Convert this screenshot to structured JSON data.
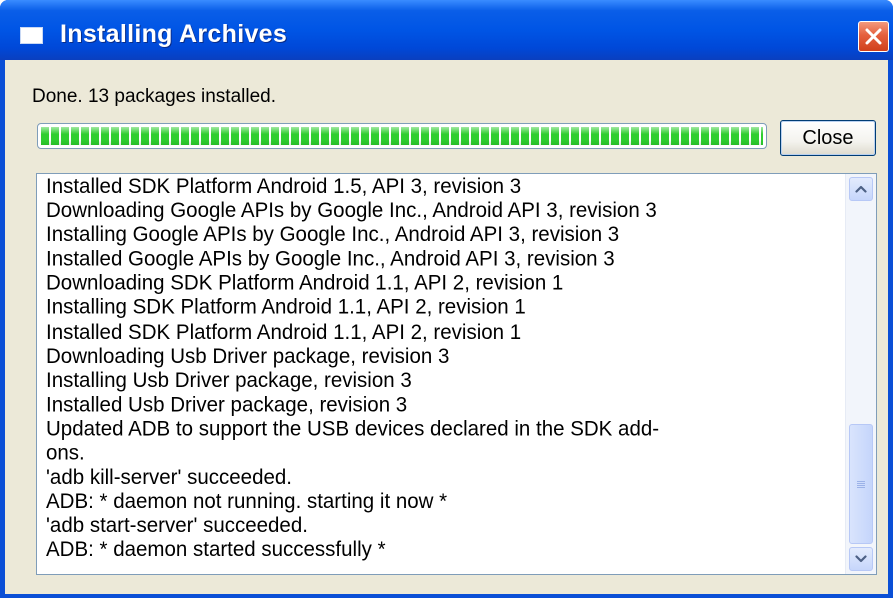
{
  "window": {
    "title": "Installing Archives",
    "icon": "window-icon",
    "close_icon": "close-icon"
  },
  "status": {
    "text": "Done. 13 packages installed."
  },
  "progress": {
    "value": 1.0,
    "color": "#2fce2f"
  },
  "buttons": {
    "close_label": "Close"
  },
  "log": {
    "lines": [
      "Installed SDK Platform Android 1.5, API 3, revision 3",
      "Downloading Google APIs by Google Inc., Android API 3, revision 3",
      "Installing Google APIs by Google Inc., Android API 3, revision 3",
      "Installed Google APIs by Google Inc., Android API 3, revision 3",
      "Downloading SDK Platform Android 1.1, API 2, revision 1",
      "Installing SDK Platform Android 1.1, API 2, revision 1",
      "Installed SDK Platform Android 1.1, API 2, revision 1",
      "Downloading Usb Driver package, revision 3",
      "Installing Usb Driver package, revision 3",
      "Installed Usb Driver package, revision 3",
      "Updated ADB to support the USB devices declared in the SDK add-",
      "ons.",
      "'adb kill-server' succeeded.",
      "ADB: * daemon not running. starting it now *",
      "'adb start-server' succeeded.",
      "ADB: * daemon started successfully *"
    ]
  },
  "scrollbar": {
    "up_icon": "chevron-up-icon",
    "down_icon": "chevron-down-icon"
  },
  "colors": {
    "titlebar": "#0055e5",
    "client": "#ece9d8",
    "close_red": "#e5603d"
  }
}
